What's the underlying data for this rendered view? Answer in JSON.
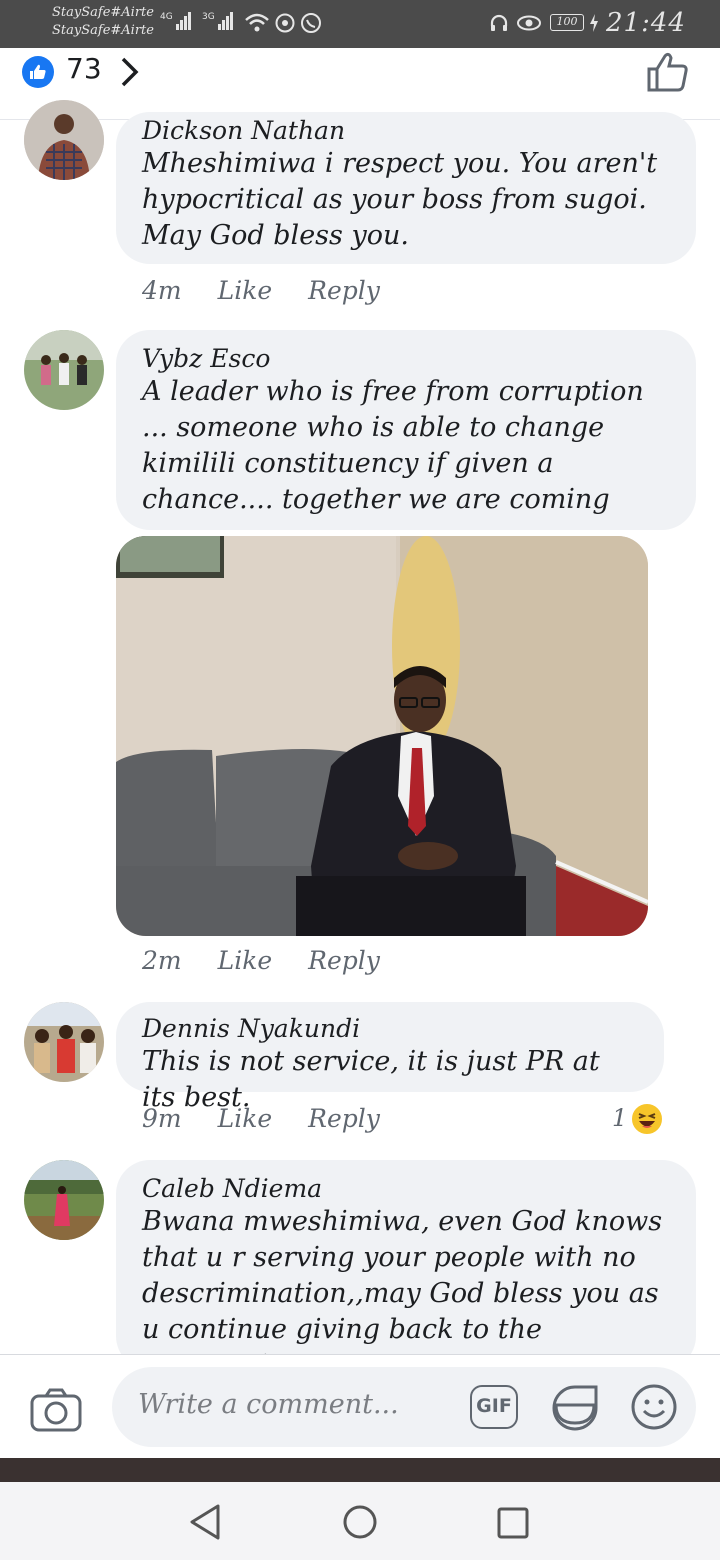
{
  "status_bar": {
    "carrier_1": "StaySafe#Airte",
    "carrier_2": "StaySafe#Airte",
    "net_1": "4G",
    "net_2": "3G",
    "battery": "100",
    "time": "21:44"
  },
  "header": {
    "reaction_count": "73"
  },
  "comments": [
    {
      "author": "Dickson Nathan",
      "text": "Mheshimiwa i respect you. You aren't hypocritical as your boss from sugoi. May God bless you.",
      "time": "4m",
      "like_label": "Like",
      "reply_label": "Reply"
    },
    {
      "author": "Vybz Esco",
      "text": "A leader who is free from corruption ... someone who is able to change kimilili constituency if given a chance.... together we are coming",
      "time": "2m",
      "like_label": "Like",
      "reply_label": "Reply"
    },
    {
      "author": "Dennis Nyakundi",
      "text": "This is not service, it is just PR at its best.",
      "time": "9m",
      "like_label": "Like",
      "reply_label": "Reply",
      "reaction_count": "1"
    },
    {
      "author": "Caleb Ndiema",
      "text": "Bwana mweshimiwa, even God knows that u r serving your people  with no descrimination,,may God bless you as u continue giving back to the community."
    }
  ],
  "composer": {
    "placeholder": "Write a comment...",
    "gif_label": "GIF"
  },
  "icons": {
    "like_badge": "thumbs-up-icon",
    "chevron": "chevron-right-icon",
    "like_outline": "thumbs-up-outline-icon",
    "camera": "camera-icon",
    "sticker": "sticker-icon",
    "emoji": "emoji-icon",
    "haha": "haha-reaction-icon",
    "nav_back": "back-triangle-icon",
    "nav_home": "home-circle-icon",
    "nav_recent": "recent-square-icon"
  },
  "colors": {
    "facebook_blue": "#1877f2",
    "bubble_gray": "#f0f2f5",
    "meta_gray": "#606770",
    "status_bar": "#4b4b4b"
  }
}
